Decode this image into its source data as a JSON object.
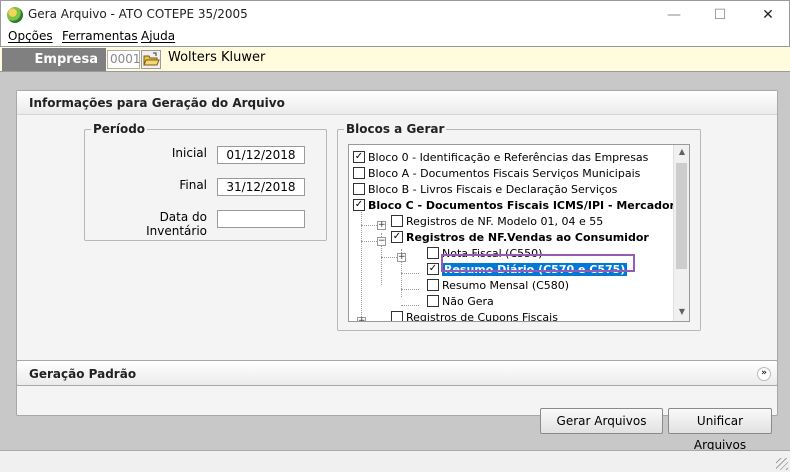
{
  "window": {
    "title": "Gera Arquivo - ATO COTEPE 35/2005",
    "minimize": "—",
    "maximize": "☐",
    "close": "✕"
  },
  "menu": {
    "items": [
      {
        "label": "Opções"
      },
      {
        "label": "Ferramentas"
      },
      {
        "label": "Ajuda"
      }
    ]
  },
  "company": {
    "label": "Empresa",
    "code": "0001",
    "name": "Wolters Kluwer"
  },
  "main_panel": {
    "title": "Informações para Geração do Arquivo",
    "periodo": {
      "title": "Período",
      "inicial_label": "Inicial",
      "inicial_value": "01/12/2018",
      "final_label": "Final",
      "final_value": "31/12/2018",
      "inventario_label": "Data do Inventário",
      "inventario_value": ""
    },
    "blocos": {
      "title": "Blocos a Gerar",
      "items": [
        {
          "label": "Bloco 0 - Identificação e Referências das Empresas",
          "checked": true
        },
        {
          "label": "Bloco A - Documentos Fiscais Serviços Municipais",
          "checked": false
        },
        {
          "label": "Bloco B - Livros Fiscais e Declaração Serviços",
          "checked": false
        },
        {
          "label": "Bloco C - Documentos Fiscais ICMS/IPI - Mercadorias",
          "checked": true
        },
        {
          "label": "Registros de NF. Modelo 01, 04 e 55",
          "checked": false
        },
        {
          "label": "Registros de NF.Vendas ao Consumidor",
          "checked": true
        },
        {
          "label": "Nota Fiscal  (C550)",
          "checked": false
        },
        {
          "label": "Resumo Diário  (C570 e C575)",
          "checked": true
        },
        {
          "label": "Resumo Mensal  (C580)",
          "checked": false
        },
        {
          "label": "Não Gera",
          "checked": false
        },
        {
          "label": "Registros de Cupons Fiscais",
          "checked": false
        }
      ]
    }
  },
  "secondary_panel": {
    "title": "Geração Padrão"
  },
  "buttons": {
    "gerar": "Gerar Arquivos",
    "unificar": "Unificar Arquivos"
  },
  "colors": {
    "selection": "#0078d7",
    "highlight_frame": "#9b59b6",
    "company_bar": "#fffbdc"
  }
}
